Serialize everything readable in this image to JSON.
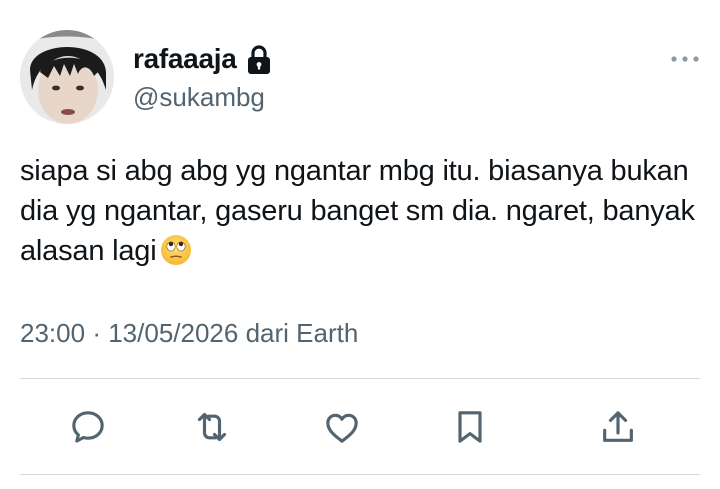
{
  "tweet": {
    "display_name": "rafaaaja",
    "handle": "@sukambg",
    "text": "siapa si abg abg yg ngantar mbg itu. biasanya bukan dia yg ngantar, gaseru banget sm dia. ngaret, banyak alasan lagi",
    "emoji": "face-with-rolling-eyes",
    "time": "23:00",
    "separator": "·",
    "date": "13/05/2026",
    "source": "dari Earth"
  },
  "icons": {
    "protected": "lock-icon",
    "more": "more-horizontal-icon",
    "reply": "reply-icon",
    "retweet": "retweet-icon",
    "like": "heart-icon",
    "bookmark": "bookmark-icon",
    "share": "share-icon"
  },
  "colors": {
    "text_primary": "#0f1419",
    "text_secondary": "#536471",
    "divider": "#cfd9de"
  }
}
